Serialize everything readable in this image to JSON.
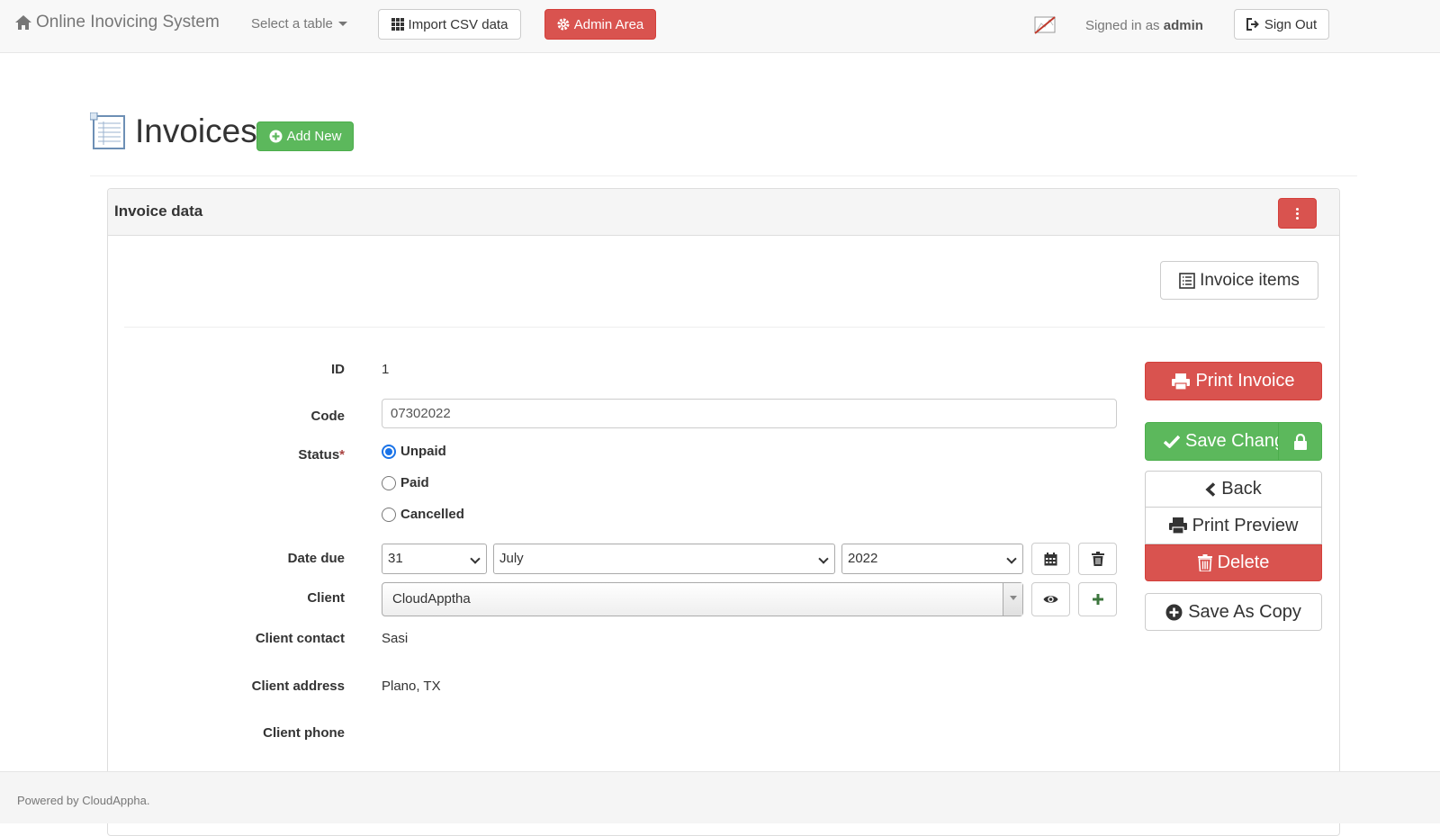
{
  "navbar": {
    "brand": "Online Inovicing System",
    "select_table": "Select a table",
    "import_csv": "Import CSV data",
    "admin_area": "Admin Area",
    "signed_in_prefix": "Signed in as",
    "signed_in_user": "admin",
    "sign_out": "Sign Out"
  },
  "page": {
    "title": "Invoices",
    "add_new": "Add New"
  },
  "panel": {
    "title": "Invoice data",
    "invoice_items": "Invoice items"
  },
  "form": {
    "id_label": "ID",
    "id_value": "1",
    "code_label": "Code",
    "code_value": "07302022",
    "status_label": "Status",
    "status_required": "*",
    "status_options": [
      "Unpaid",
      "Paid",
      "Cancelled"
    ],
    "status_selected": "Unpaid",
    "date_due_label": "Date due",
    "date_day": "31",
    "date_month": "July",
    "date_year": "2022",
    "client_label": "Client",
    "client_value": "CloudApptha",
    "client_contact_label": "Client contact",
    "client_contact_value": "Sasi",
    "client_address_label": "Client address",
    "client_address_value": "Plano, TX",
    "client_phone_label": "Client phone"
  },
  "actions": {
    "print_invoice": "Print Invoice",
    "save_changes": "Save Chang",
    "back": "Back",
    "print_preview": "Print Preview",
    "delete": "Delete",
    "save_as_copy": "Save As Copy"
  },
  "footer": {
    "text": "Powered by CloudAppha."
  },
  "colors": {
    "danger": "#d9534f",
    "success": "#5cb85c",
    "navbar_bg": "#f8f8f8"
  }
}
